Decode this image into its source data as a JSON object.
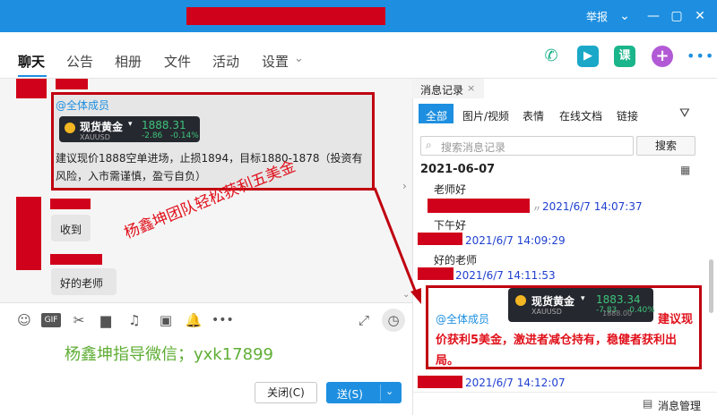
{
  "titlebar": {
    "report": "举报",
    "buttons": [
      "⌄",
      "—",
      "▢",
      "✕"
    ]
  },
  "nav": {
    "tabs": [
      "聊天",
      "公告",
      "相册",
      "文件",
      "活动",
      "设置"
    ],
    "settings_caret": "⌄"
  },
  "price_widget": {
    "name": "现货黄金",
    "code": "XAUUSD",
    "price": "1888.31",
    "change": "-2.86",
    "pct": "-0.14%"
  },
  "price_widget2": {
    "name": "现货黄金",
    "code": "XAUUSD",
    "price": "1883.34",
    "change": "-7.83",
    "pct": "-0.40%",
    "overlap": "1888.00"
  },
  "chat": {
    "msg1_mention": "@全体成员",
    "msg1_text": "建议现价1888空单进场，止损1894，目标1880-1878（投资有风险，入市需谨慎，盈亏自负）",
    "msg2": "收到",
    "msg3": "好的老师"
  },
  "overlay": {
    "team_text": "杨鑫坤团队轻松获利五美金",
    "wechat_text": "杨鑫坤指导微信；yxk17899"
  },
  "composer": {
    "close_label": "关闭(C)",
    "send_label": "送(S)"
  },
  "right_panel": {
    "tab_title": "消息记录",
    "filter_tabs": [
      "全部",
      "图片/视频",
      "表情",
      "在线文档",
      "链接"
    ],
    "search_placeholder": "搜索消息记录",
    "search_button": "搜索",
    "date_header": "2021-06-07",
    "entries": [
      {
        "text": "老师好",
        "time": "2021/6/7 14:07:37"
      },
      {
        "text": "下午好",
        "time": "2021/6/7 14:09:29"
      },
      {
        "text": "好的老师",
        "time": "2021/6/7 14:11:53"
      }
    ],
    "highlight_mention": "@全体成员",
    "highlight_text": "建议现价获利5美金，激进者减仓持有，稳健者获利出局。",
    "last_time": "2021/6/7 14:12:07",
    "manage_label": "消息管理"
  },
  "colors": {
    "accent": "#1e8fe0",
    "redaction": "#d0021b",
    "up_green": "#3ec37a",
    "down_red": "#e0101a"
  }
}
